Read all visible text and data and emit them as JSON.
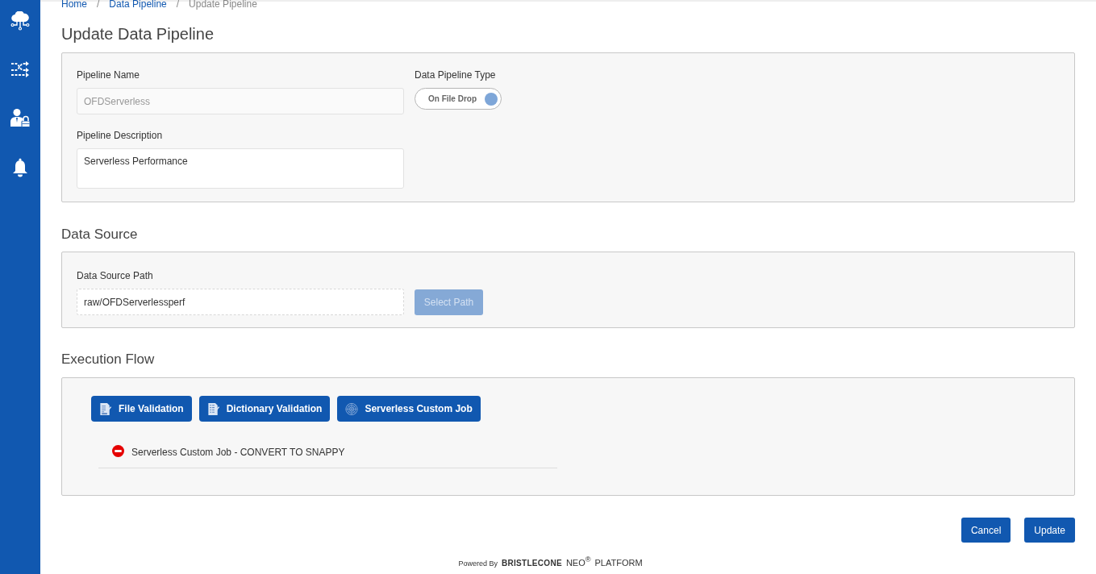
{
  "breadcrumb": [
    {
      "label": "Home",
      "kind": "link"
    },
    {
      "separator": "/",
      "label": "Data Pipeline",
      "kind": "link"
    },
    {
      "separator": "/",
      "label": "Update Pipeline",
      "kind": "current"
    }
  ],
  "title": "Update Data Pipeline",
  "pipeline_panel": {
    "name_field": {
      "label": "Pipeline Name",
      "value": "OFDServerless",
      "disabled": true
    },
    "type_field": {
      "label": "Data Pipeline Type",
      "toggle": {
        "label": "On File Drop",
        "on": true
      }
    },
    "description_field": {
      "label": "Pipeline Description",
      "value": "Serverless Performance"
    }
  },
  "data_source": {
    "heading": "Data Source",
    "path_field": {
      "label": "Data Source Path",
      "value": "raw/OFDServerlessperf"
    },
    "select_button": {
      "label": "Select Path",
      "disabled": true
    }
  },
  "execution_flow": {
    "heading": "Execution Flow",
    "job_buttons": [
      {
        "label": "File Validation",
        "kind": "file"
      },
      {
        "label": "Dictionary Validation",
        "kind": "dictionary"
      },
      {
        "label": "Serverless Custom Job",
        "kind": "custom"
      }
    ],
    "steps": [
      {
        "label": "Serverless Custom Job - CONVERT TO SNAPPY"
      }
    ]
  },
  "actions": [
    {
      "label": "Cancel"
    },
    {
      "label": "Update"
    }
  ],
  "footer": {
    "prefix": "Powered By",
    "brand": "BRISTLECONE",
    "product": "NEO$^{®}$",
    "suffix": "PLATFORM"
  }
}
